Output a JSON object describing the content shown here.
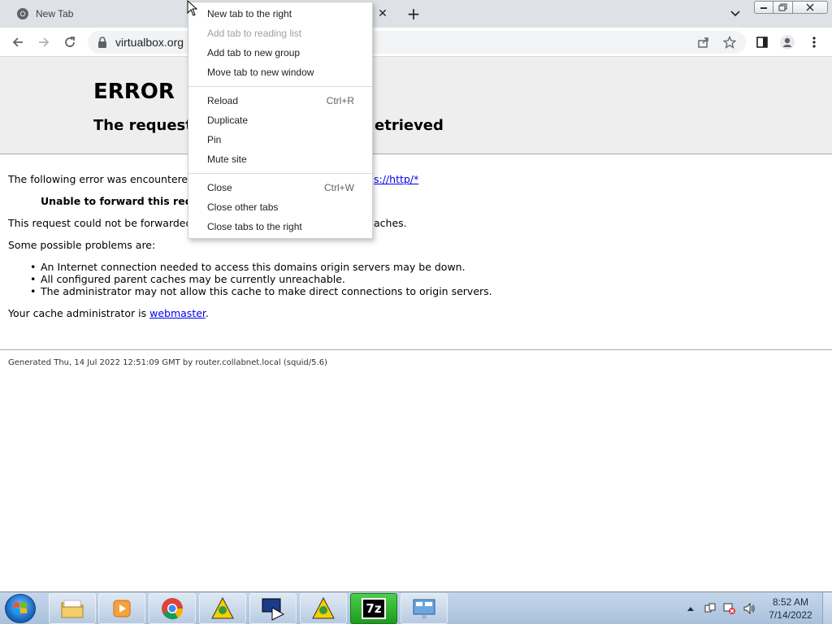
{
  "browser": {
    "tab": {
      "title": "New Tab"
    },
    "url": "virtualbox.org",
    "tab_close_glyph": "✕",
    "new_tab_glyph": "+"
  },
  "page": {
    "title": "ERROR",
    "subtitle_left": "The request",
    "subtitle_right": "etrieved",
    "line1_left": "The following error was encountered",
    "line1_link": "s://http/*",
    "unable_text": "Unable to forward this requ",
    "line2_left": "This request could not be forwarded",
    "line2_right": "aches.",
    "problems_heading": "Some possible problems are:",
    "problems": [
      "An Internet connection needed to access this domains origin servers may be down.",
      "All configured parent caches may be currently unreachable.",
      "The administrator may not allow this cache to make direct connections to origin servers."
    ],
    "admin_prefix": "Your cache administrator is ",
    "admin_link": "webmaster",
    "admin_suffix": ".",
    "footer": "Generated Thu, 14 Jul 2022 12:51:09 GMT by router.collabnet.local (squid/5.6)"
  },
  "context_menu": {
    "items": [
      {
        "label": "New tab to the right",
        "shortcut": "",
        "disabled": false
      },
      {
        "label": "Add tab to reading list",
        "shortcut": "",
        "disabled": true
      },
      {
        "label": "Add tab to new group",
        "shortcut": "",
        "disabled": false
      },
      {
        "label": "Move tab to new window",
        "shortcut": "",
        "disabled": false
      },
      {
        "label": "Reload",
        "shortcut": "Ctrl+R",
        "disabled": false
      },
      {
        "label": "Duplicate",
        "shortcut": "",
        "disabled": false
      },
      {
        "label": "Pin",
        "shortcut": "",
        "disabled": false
      },
      {
        "label": "Mute site",
        "shortcut": "",
        "disabled": false
      },
      {
        "label": "Close",
        "shortcut": "Ctrl+W",
        "disabled": false
      },
      {
        "label": "Close other tabs",
        "shortcut": "",
        "disabled": false
      },
      {
        "label": "Close tabs to the right",
        "shortcut": "",
        "disabled": false
      }
    ]
  },
  "taskbar": {
    "clock_time": "8:52 AM",
    "clock_date": "7/14/2022",
    "apps": [
      "file-explorer",
      "media-player",
      "chrome",
      "unknown-app",
      "realplayer",
      "unknown-app",
      "7zip",
      "control-panel"
    ],
    "active_app": "7zip",
    "app_7zip_label": "7z"
  },
  "colors": {
    "link": "#0000ee",
    "disabled_menu_text": "#a0a0a0",
    "taskbar": "#b8cce4"
  }
}
